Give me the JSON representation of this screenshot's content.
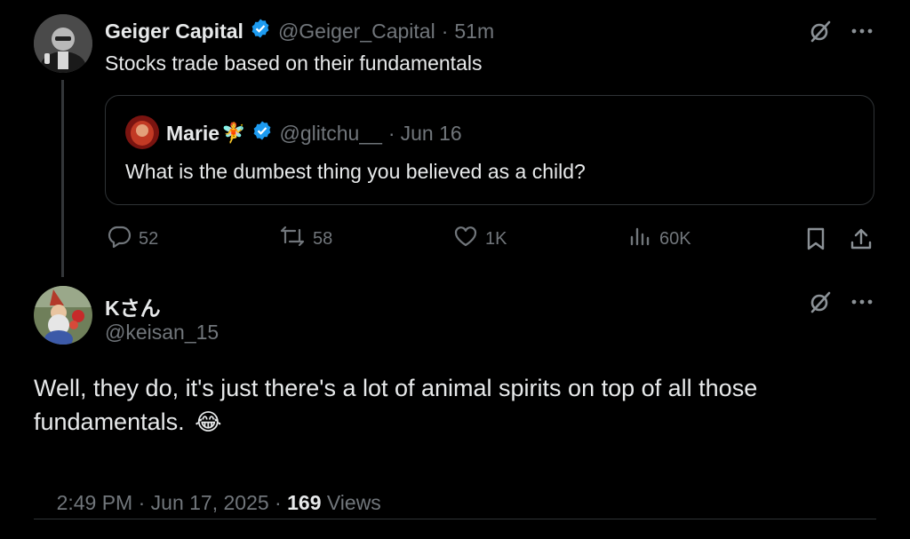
{
  "parent_tweet": {
    "author_name": "Geiger Capital",
    "handle": "@Geiger_Capital",
    "separator": "·",
    "time": "51m",
    "text": "Stocks trade based on their fundamentals",
    "quote": {
      "author_name": "Marie",
      "author_emoji": "🧚",
      "handle": "@glitchu__",
      "separator": "·",
      "date": "Jun 16",
      "text": "What is the dumbest thing you believed as a child?"
    },
    "metrics": {
      "replies": "52",
      "reposts": "58",
      "likes": "1K",
      "views": "60K"
    }
  },
  "reply_tweet": {
    "author_name": "Kさん",
    "handle": "@keisan_15",
    "text": "Well, they do, it's just there's a lot of animal spirits on top of all those fundamentals.",
    "emoji": "😂",
    "timestamp": "2:49 PM · Jun 17, 2025 · ",
    "views_count": "169",
    "views_label": "Views"
  },
  "colors": {
    "background": "#000000",
    "text": "#e7e9ea",
    "muted": "#71767b",
    "border": "#2f3336",
    "verified": "#1d9bf0"
  },
  "icons": [
    "grok-icon",
    "more-icon",
    "reply-icon",
    "repost-icon",
    "like-icon",
    "views-icon",
    "bookmark-icon",
    "share-icon",
    "verified-badge-icon"
  ]
}
